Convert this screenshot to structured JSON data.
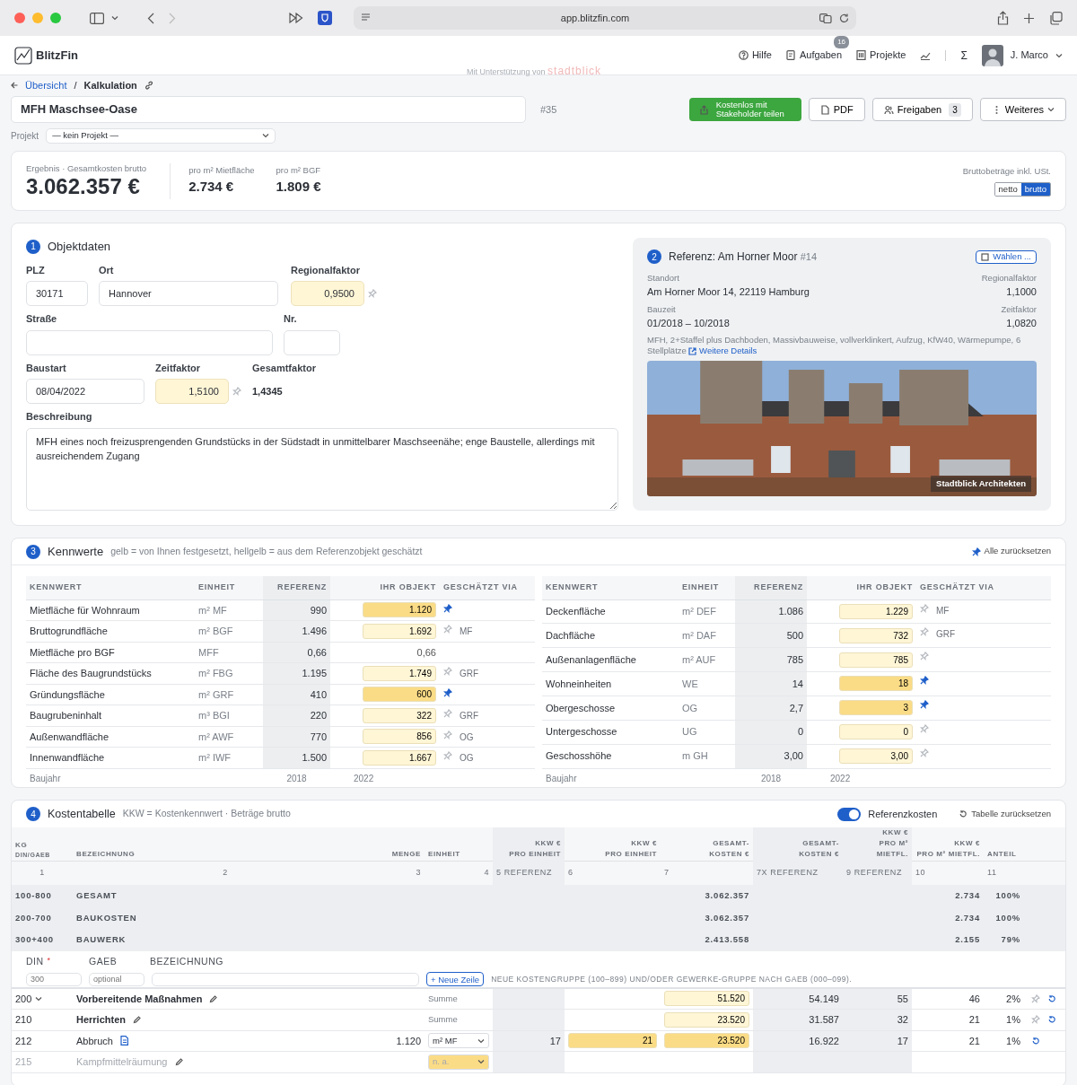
{
  "browser": {
    "url": "app.blitzfin.com"
  },
  "header": {
    "brand": "BlitzFin",
    "sponsor_prefix": "Mit Unterstützung von",
    "sponsor": "stadtblick",
    "nav": [
      {
        "kind": "help",
        "label": "Hilfe"
      },
      {
        "kind": "tasks",
        "label": "Aufgaben",
        "badge": "16"
      },
      {
        "kind": "projects",
        "label": "Projekte"
      }
    ],
    "sigma": "Σ",
    "user": "J. Marco"
  },
  "breadcrumb": [
    {
      "kind": "link",
      "label": "Übersicht"
    },
    {
      "kind": "separator",
      "label": "/"
    },
    {
      "kind": "current",
      "label": "Kalkulation"
    }
  ],
  "project": {
    "title": "MFH Maschsee-Oase",
    "number": "#35",
    "projekt_label": "Projekt",
    "projekt_value": "— kein Projekt —"
  },
  "actions": [
    {
      "kind": "share",
      "label": "Kostenlos mit Stakeholder teilen"
    },
    {
      "kind": "pdf",
      "label": "PDF"
    },
    {
      "kind": "shares",
      "label": "Freigaben",
      "count": "3"
    },
    {
      "kind": "more",
      "label": "Weiteres"
    }
  ],
  "result": {
    "label": "Ergebnis · Gesamtkosten brutto",
    "value": "3.062.357 €",
    "per": [
      {
        "label": "pro m² Mietfläche",
        "value": "2.734 €"
      },
      {
        "label": "pro m² BGF",
        "value": "1.809 €"
      }
    ],
    "note": "Bruttobeträge inkl. USt.",
    "modes": [
      {
        "label": "netto",
        "selected": false
      },
      {
        "label": "brutto",
        "selected": true
      }
    ]
  },
  "objekt": {
    "number": "1",
    "title": "Objektdaten",
    "plz": {
      "label": "PLZ",
      "value": "30171"
    },
    "ort": {
      "label": "Ort",
      "value": "Hannover"
    },
    "regionalfaktor": {
      "label": "Regionalfaktor",
      "value": "0,9500",
      "pinned": false
    },
    "strasse": {
      "label": "Straße"
    },
    "nr": {
      "label": "Nr."
    },
    "baustart": {
      "label": "Baustart",
      "value": "08/04/2022"
    },
    "zeitfaktor": {
      "label": "Zeitfaktor",
      "value": "1,5100",
      "pinned": false
    },
    "gesamtfaktor": {
      "label": "Gesamtfaktor",
      "value": "1,4345"
    },
    "beschreibung": {
      "label": "Beschreibung",
      "value": "MFH eines noch freizusprengenden Grundstücks in der Südstadt in unmittelbarer Maschseenähe; enge Baustelle, allerdings mit ausreichendem Zugang"
    }
  },
  "referenz": {
    "number": "2",
    "title": "Referenz: Am Horner Moor",
    "id": "#14",
    "button": "Wählen ...",
    "standort_label": "Standort",
    "standort": "Am Horner Moor 14, 22119 Hamburg",
    "regional_label": "Regionalfaktor",
    "regional": "1,1000",
    "bauzeit_label": "Bauzeit",
    "bauzeit": "01/2018 – 10/2018",
    "zeit_label": "Zeitfaktor",
    "zeit": "1,0820",
    "description": "MFH, 2+Staffel plus Dachboden, Massivbauweise, vollverklinkert, Aufzug, KfW40, Wärmepumpe, 6 Stellplätze",
    "link": "Weitere Details",
    "photo": {
      "kind": "picture",
      "caption": "Stadtblick Architekten"
    }
  },
  "kennwerte": {
    "number": "3",
    "title": "Kennwerte",
    "legend": "gelb = von Ihnen festgesetzt, hellgelb = aus dem Referenzobjekt geschätzt",
    "reset": "Alle zurücksetzen",
    "tables": [
      {
        "columns": [
          "KENNWERT",
          "EINHEIT",
          "REFERENZ",
          "IHR OBJEKT",
          "GESCHÄTZT VIA"
        ],
        "rows": [
          {
            "kind": "input",
            "name": "Mietfläche für Wohnraum",
            "unit": "m² MF",
            "ref": "990",
            "value": "1.120",
            "pinned": true
          },
          {
            "kind": "input",
            "name": "Bruttogrundfläche",
            "unit": "m² BGF",
            "ref": "1.496",
            "value": "1.692",
            "pinned": false,
            "via": "MF"
          },
          {
            "kind": "plain",
            "name": "Mietfläche pro BGF",
            "unit": "MFF",
            "ref": "0,66",
            "value": "0,66"
          },
          {
            "kind": "input",
            "name": "Fläche des Baugrundstücks",
            "unit": "m² FBG",
            "ref": "1.195",
            "value": "1.749",
            "pinned": false,
            "via": "GRF"
          },
          {
            "kind": "input",
            "name": "Gründungsfläche",
            "unit": "m² GRF",
            "ref": "410",
            "value": "600",
            "pinned": true
          },
          {
            "kind": "input",
            "name": "Baugrubeninhalt",
            "unit": "m³ BGI",
            "ref": "220",
            "value": "322",
            "pinned": false,
            "via": "GRF"
          },
          {
            "kind": "input",
            "name": "Außenwandfläche",
            "unit": "m² AWF",
            "ref": "770",
            "value": "856",
            "pinned": false,
            "via": "OG"
          },
          {
            "kind": "input",
            "name": "Innenwandfläche",
            "unit": "m² IWF",
            "ref": "1.500",
            "value": "1.667",
            "pinned": false,
            "via": "OG"
          }
        ],
        "footer": {
          "label": "Baujahr",
          "ref": "2018",
          "value": "2022"
        }
      },
      {
        "columns": [
          "KENNWERT",
          "EINHEIT",
          "REFERENZ",
          "IHR OBJEKT",
          "GESCHÄTZT VIA"
        ],
        "rows": [
          {
            "kind": "input",
            "name": "Deckenfläche",
            "unit": "m² DEF",
            "ref": "1.086",
            "value": "1.229",
            "pinned": false,
            "via": "MF"
          },
          {
            "kind": "input",
            "name": "Dachfläche",
            "unit": "m² DAF",
            "ref": "500",
            "value": "732",
            "pinned": false,
            "via": "GRF"
          },
          {
            "kind": "input",
            "name": "Außenanlagenfläche",
            "unit": "m² AUF",
            "ref": "785",
            "value": "785",
            "pinned": false
          },
          {
            "kind": "input",
            "name": "Wohneinheiten",
            "unit": "WE",
            "ref": "14",
            "value": "18",
            "pinned": true
          },
          {
            "kind": "input",
            "name": "Obergeschosse",
            "unit": "OG",
            "ref": "2,7",
            "value": "3",
            "pinned": true
          },
          {
            "kind": "input",
            "name": "Untergeschosse",
            "unit": "UG",
            "ref": "0",
            "value": "0",
            "pinned": false
          },
          {
            "kind": "input",
            "name": "Geschosshöhe",
            "unit": "m GH",
            "ref": "3,00",
            "value": "3,00",
            "pinned": false
          }
        ],
        "footer": {
          "label": "Baujahr",
          "ref": "2018",
          "value": "2022"
        }
      }
    ]
  },
  "kosten": {
    "number": "4",
    "title": "Kostentabelle",
    "subtitle": "KKW = Kostenkennwert · Beträge brutto",
    "toggle": {
      "label": "Referenzkosten",
      "on": true
    },
    "reset": "Tabelle zurücksetzen",
    "columns": [
      {
        "top": "KG",
        "bottom": "DIN/GAEB"
      },
      {
        "bottom": "BEZEICHNUNG"
      },
      {
        "bottom": "MENGE"
      },
      {
        "bottom": "EINHEIT"
      },
      {
        "top": "KKW €",
        "bottom": "PRO EINHEIT"
      },
      {
        "top": "KKW €",
        "bottom": "PRO EINHEIT"
      },
      {
        "top": "GESAMT-",
        "bottom": "KOSTEN €"
      },
      {
        "top": "GESAMT-",
        "bottom": "KOSTEN €"
      },
      {
        "top": "KKW €",
        "bottom": "PRO M² MIETFL."
      },
      {
        "top": "KKW €",
        "bottom": "PRO M² MIETFL."
      },
      {
        "bottom": "ANTEIL"
      }
    ],
    "numbers": [
      "1",
      "2",
      "3",
      "4",
      "5 REFERENZ",
      "6",
      "7",
      "7X REFERENZ",
      "9 REFERENZ",
      "10",
      "11"
    ],
    "summary": [
      {
        "kg": "100-800",
        "name": "GESAMT",
        "total": "3.062.357",
        "per_area": "2.734",
        "share": "100%"
      },
      {
        "kg": "200-700",
        "name": "BAUKOSTEN",
        "total": "3.062.357",
        "per_area": "2.734",
        "share": "100%"
      },
      {
        "kg": "300+400",
        "name": "BAUWERK",
        "total": "2.413.558",
        "per_area": "2.155",
        "share": "79%"
      }
    ],
    "new_row": {
      "din_label": "DIN",
      "required_mark": "*",
      "gaeb_label": "GAEB",
      "name_label": "BEZEICHNUNG",
      "din_placeholder": "300",
      "gaeb_placeholder": "optional",
      "button": "Neue Zeile",
      "button_sign": "+",
      "hint": "NEUE KOSTENGRUPPE (100–899) UND/ODER GEWERKE-GRUPPE NACH GAEB (000–099)."
    },
    "rows": [
      {
        "kind": "group",
        "kg": "200",
        "expanded": true,
        "name": "Vorbereitende Maßnahmen",
        "unit": {
          "kind": "text",
          "text": "Summe"
        },
        "total": {
          "text": "51.520",
          "pinned": false
        },
        "total_ref": "54.149",
        "area_ref": "55",
        "area": "46",
        "share": "2%",
        "pinned": false,
        "resettable": true
      },
      {
        "kind": "group",
        "kg": "210",
        "name": "Herrichten",
        "unit": {
          "kind": "text",
          "text": "Summe"
        },
        "total": {
          "text": "23.520",
          "pinned": false
        },
        "total_ref": "31.587",
        "area_ref": "32",
        "area": "21",
        "share": "1%",
        "pinned": false,
        "resettable": true
      },
      {
        "kind": "item",
        "kg": "212",
        "name": "Abbruch",
        "qty": "1.120",
        "unit": {
          "kind": "select",
          "text": "m² MF"
        },
        "unit_ref": "17",
        "unit_cost": {
          "text": "21",
          "pinned": true
        },
        "total": {
          "text": "23.520",
          "pinned": true
        },
        "total_ref": "16.922",
        "area_ref": "17",
        "area": "21",
        "share": "1%",
        "resettable": true
      },
      {
        "kind": "disabled",
        "kg": "215",
        "name": "Kampfmittelräumung",
        "unit": {
          "kind": "select",
          "text": "n. a.",
          "pinned": true
        }
      }
    ]
  }
}
